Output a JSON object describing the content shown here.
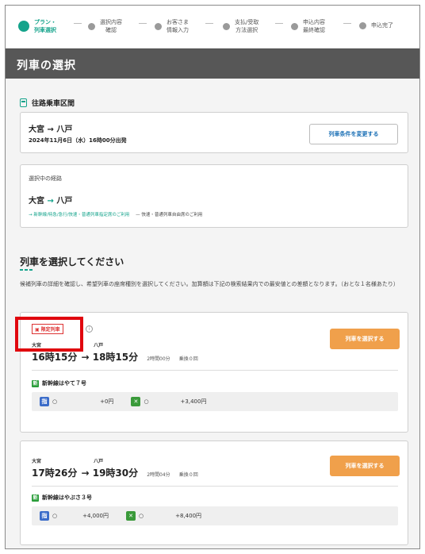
{
  "stepper": {
    "steps": [
      {
        "label": "プラン・\n列車選択",
        "active": true
      },
      {
        "label": "選択内容\n確認",
        "active": false
      },
      {
        "label": "お客さま\n情報入力",
        "active": false
      },
      {
        "label": "支払/受取\n方法選択",
        "active": false
      },
      {
        "label": "申込内容\n最終確認",
        "active": false
      },
      {
        "label": "申込完了",
        "active": false
      }
    ]
  },
  "page": {
    "title": "列車の選択"
  },
  "outbound": {
    "heading": "往路乗車区間",
    "route": "大宮 → 八戸",
    "datetime": "2024年11月6日（水）16時00分出発",
    "change_button": "列車条件を変更する"
  },
  "selected_route": {
    "label": "選択中の経路",
    "from": "大宮",
    "to": "八戸",
    "detail_left": "→ 新幹線/特急/急行/快速・普通列車指定席のご利用",
    "detail_right": "— 快速・普通列車自由席のご利用"
  },
  "select_section": {
    "heading": "列車を選択してください",
    "intro": "候補列車の詳細を確認し、希望列車の座席種別を選択してください。加算額は下記の検索結果内での最安値との差額となります。（おとな１名様あたり）"
  },
  "trains": [
    {
      "tag": "限定列車",
      "from": "大宮",
      "to": "八戸",
      "dep": "16時15分",
      "arr": "18時15分",
      "duration": "2時間00分",
      "transfers": "乗換０回",
      "select_label": "列車を選択する",
      "service": "新幹線はやて７号",
      "reserved_mark": "指",
      "reserved_status": "○",
      "reserved_price": "+0円",
      "green_status": "○",
      "green_price": "+3,400円"
    },
    {
      "tag": "",
      "from": "大宮",
      "to": "八戸",
      "dep": "17時26分",
      "arr": "19時30分",
      "duration": "2時間04分",
      "transfers": "乗換０回",
      "select_label": "列車を選択する",
      "service": "新幹線はやぶさ３号",
      "reserved_mark": "指",
      "reserved_status": "○",
      "reserved_price": "+4,000円",
      "green_status": "○",
      "green_price": "+8,400円"
    }
  ],
  "colors": {
    "accent_green": "#14a38b",
    "title_bar": "#575757",
    "select_orange": "#f0a04b",
    "highlight_red": "#e0060e"
  }
}
